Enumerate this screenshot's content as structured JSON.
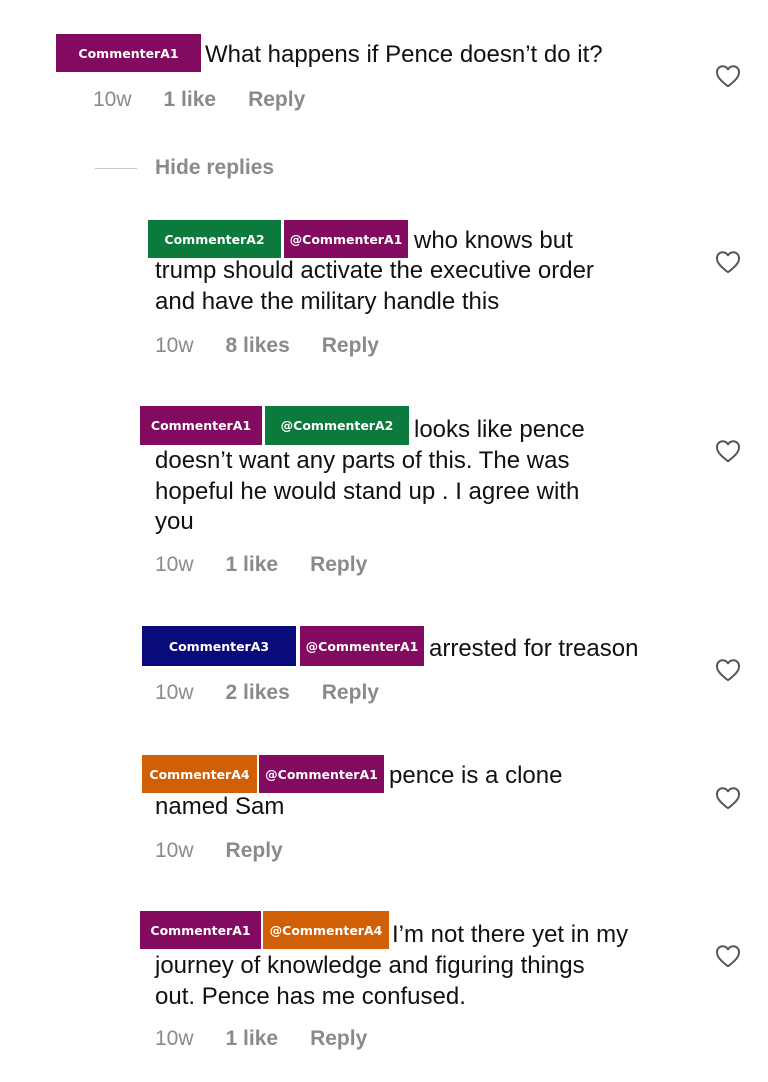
{
  "colors": {
    "purple": "#820a5f",
    "green": "#0b7a3c",
    "navy": "#0a0a7d",
    "orange": "#d05f06",
    "meta_gray": "#8a8a8a"
  },
  "icons": {
    "like": "heart-outline-icon"
  },
  "hide_replies_label": "Hide replies",
  "comments": [
    {
      "author": "CommenterA1",
      "text": "What happens if Pence doesn’t do it?",
      "age": "10w",
      "likes": "1 like",
      "reply_label": "Reply"
    }
  ],
  "replies": [
    {
      "author": "CommenterA2",
      "mention": "@CommenterA1",
      "text_first": "who knows but",
      "text_rest": "trump should activate the executive order\nand have the military handle this",
      "age": "10w",
      "likes": "8 likes",
      "reply_label": "Reply"
    },
    {
      "author": "CommenterA1",
      "mention": "@CommenterA2",
      "text_first": "looks like pence",
      "text_rest": "doesn’t want any parts of this. The was\nhopeful he would stand up . I agree with\nyou",
      "age": "10w",
      "likes": "1 like",
      "reply_label": "Reply"
    },
    {
      "author": "CommenterA3",
      "mention": "@CommenterA1",
      "text_first": "arrested for treason",
      "text_rest": "",
      "age": "10w",
      "likes": "2 likes",
      "reply_label": "Reply"
    },
    {
      "author": "CommenterA4",
      "mention": "@CommenterA1",
      "text_first": "pence is a clone",
      "text_rest": "named Sam",
      "age": "10w",
      "likes": "",
      "reply_label": "Reply"
    },
    {
      "author": "CommenterA1",
      "mention": "@CommenterA4",
      "text_first": "I’m not there yet in my",
      "text_rest": "journey of knowledge and figuring things\nout. Pence has me confused.",
      "age": "10w",
      "likes": "1 like",
      "reply_label": "Reply"
    }
  ]
}
